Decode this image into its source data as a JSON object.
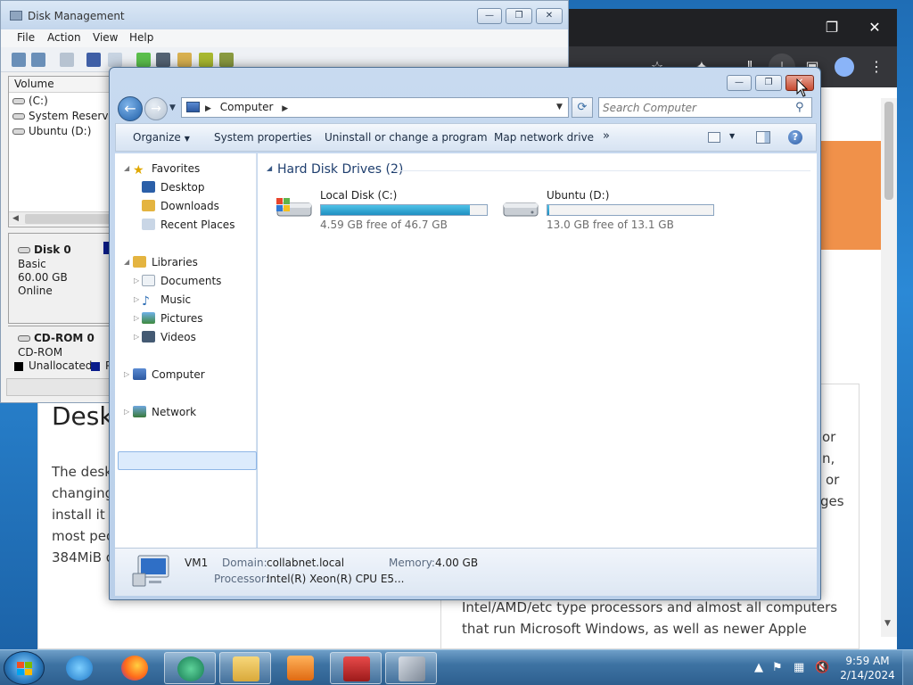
{
  "disk_management": {
    "title": "Disk Management",
    "menu": [
      "File",
      "Action",
      "View",
      "Help"
    ],
    "column_volume": "Volume",
    "volumes": [
      "(C:)",
      "System Reserved",
      "Ubuntu (D:)"
    ],
    "disk0": {
      "name": "Disk 0",
      "type": "Basic",
      "size": "60.00 GB",
      "status": "Online"
    },
    "cdrom": {
      "name": "CD-ROM 0",
      "type": "CD-ROM"
    },
    "legend": {
      "unallocated": "Unallocated",
      "primary": "P"
    }
  },
  "browser_article": {
    "heading": "Deskt",
    "left_lines": [
      "The desk",
      "changing",
      "install it p",
      "most peo",
      "384MiB o"
    ],
    "right_fragments": [
      "or",
      "n,",
      "or",
      "ges"
    ],
    "bottom_lines": [
      "Intel/AMD/etc type processors and almost all computers",
      "that run Microsoft Windows, as well as newer Apple"
    ]
  },
  "explorer": {
    "window_controls": {
      "minimize": "—",
      "restore": "❐",
      "close": "✕"
    },
    "address": {
      "root": "Computer"
    },
    "search": {
      "placeholder": "Search Computer"
    },
    "toolbar": {
      "organize": "Organize",
      "system_properties": "System properties",
      "uninstall": "Uninstall or change a program",
      "map_drive": "Map network drive",
      "more": "»"
    },
    "nav": {
      "favorites": "Favorites",
      "desktop": "Desktop",
      "downloads": "Downloads",
      "recent": "Recent Places",
      "libraries": "Libraries",
      "documents": "Documents",
      "music": "Music",
      "pictures": "Pictures",
      "videos": "Videos",
      "computer": "Computer",
      "network": "Network"
    },
    "group_header": "Hard Disk Drives (2)",
    "drives": [
      {
        "name": "Local Disk (C:)",
        "free": "4.59 GB free of 46.7 GB",
        "used_fraction": 0.9
      },
      {
        "name": "Ubuntu (D:)",
        "free": "13.0 GB free of 13.1 GB",
        "used_fraction": 0.01
      }
    ],
    "details": {
      "name": "VM1",
      "domain_label": "Domain:",
      "domain": "collabnet.local",
      "memory_label": "Memory:",
      "memory": "4.00 GB",
      "processor_label": "Processor:",
      "processor": "Intel(R) Xeon(R) CPU E5..."
    }
  },
  "taskbar": {
    "time": "9:59 AM",
    "date": "2/14/2024"
  },
  "colors": {
    "progress_fill": "#1f8fc2",
    "selection": "#dcebfc",
    "accent_orange": "#f0914a"
  }
}
